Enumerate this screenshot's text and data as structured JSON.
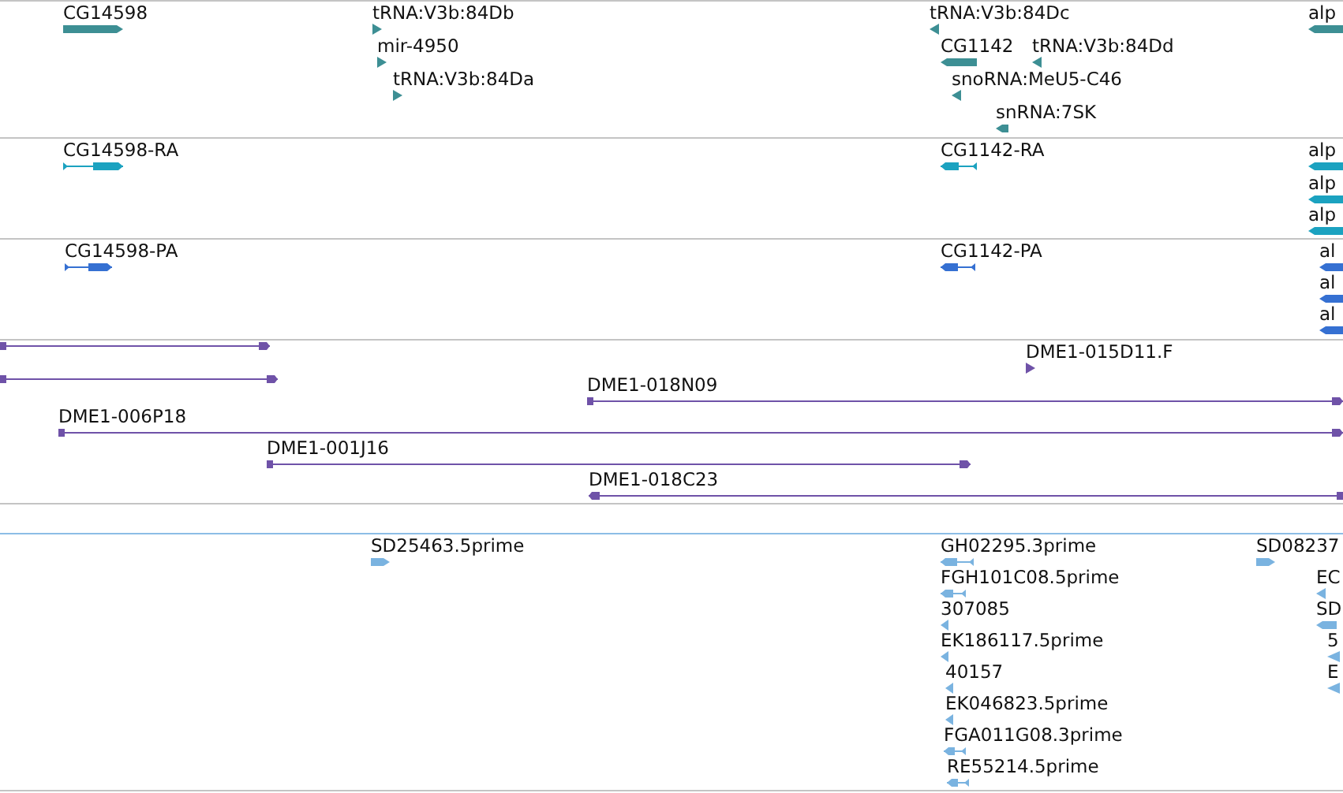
{
  "tracks": [
    {
      "color": "#3d8f94",
      "features": [
        {
          "label": "CG14598",
          "kind": "gene",
          "reverse": false
        },
        {
          "label": "tRNA:V3b:84Db",
          "kind": "small",
          "reverse": false
        },
        {
          "label": "mir-4950",
          "kind": "small",
          "reverse": false
        },
        {
          "label": "tRNA:V3b:84Da",
          "kind": "small",
          "reverse": false
        },
        {
          "label": "tRNA:V3b:84Dc",
          "kind": "small",
          "reverse": true
        },
        {
          "label": "CG1142",
          "kind": "gene",
          "reverse": true
        },
        {
          "label": "tRNA:V3b:84Dd",
          "kind": "small",
          "reverse": true
        },
        {
          "label": "snoRNA:MeU5-C46",
          "kind": "small",
          "reverse": true
        },
        {
          "label": "snRNA:7SK",
          "kind": "gene",
          "reverse": true
        },
        {
          "label": "alp",
          "kind": "gene",
          "reverse": true
        }
      ]
    },
    {
      "color": "#1ba2c0",
      "features": [
        {
          "label": "CG14598-RA",
          "kind": "transcript",
          "reverse": false
        },
        {
          "label": "CG1142-RA",
          "kind": "transcript",
          "reverse": true
        },
        {
          "label": "alp",
          "kind": "gene",
          "reverse": true
        },
        {
          "label": "alp",
          "kind": "gene",
          "reverse": true
        },
        {
          "label": "alp",
          "kind": "gene",
          "reverse": true
        }
      ]
    },
    {
      "color": "#3570d2",
      "features": [
        {
          "label": "CG14598-PA",
          "kind": "transcript",
          "reverse": false
        },
        {
          "label": "CG1142-PA",
          "kind": "transcript",
          "reverse": true
        },
        {
          "label": "al",
          "kind": "gene",
          "reverse": true
        },
        {
          "label": "al",
          "kind": "gene",
          "reverse": true
        },
        {
          "label": "al",
          "kind": "gene",
          "reverse": true
        }
      ]
    },
    {
      "color": "#6f52a8",
      "features": [
        {
          "kind": "clone",
          "reverse": false
        },
        {
          "kind": "clone",
          "reverse": false
        },
        {
          "label": "DME1-015D11.F",
          "kind": "small",
          "reverse": false
        },
        {
          "label": "DME1-018N09",
          "kind": "clone",
          "reverse": false
        },
        {
          "label": "DME1-006P18",
          "kind": "clone",
          "reverse": false
        },
        {
          "label": "DME1-001J16",
          "kind": "clone",
          "reverse": false
        },
        {
          "label": "DME1-018C23",
          "kind": "clone",
          "reverse": true
        }
      ]
    },
    {
      "color": "#7ab3e0",
      "features": [
        {
          "label": "SD25463.5prime",
          "kind": "gene",
          "reverse": false
        },
        {
          "label": "GH02295.3prime",
          "kind": "transcript",
          "reverse": true
        },
        {
          "label": "FGH101C08.5prime",
          "kind": "transcript",
          "reverse": true
        },
        {
          "label": "307085",
          "kind": "small",
          "reverse": true
        },
        {
          "label": "EK186117.5prime",
          "kind": "small",
          "reverse": true
        },
        {
          "label": "40157",
          "kind": "small",
          "reverse": true
        },
        {
          "label": "EK046823.5prime",
          "kind": "small",
          "reverse": true
        },
        {
          "label": "FGA011G08.3prime",
          "kind": "transcript",
          "reverse": true
        },
        {
          "label": "RE55214.5prime",
          "kind": "transcript",
          "reverse": true
        },
        {
          "label": "SD08237",
          "kind": "gene",
          "reverse": false
        },
        {
          "label": "EC",
          "kind": "small",
          "reverse": true
        },
        {
          "label": "SD",
          "kind": "gene",
          "reverse": true
        },
        {
          "label": "5",
          "kind": "small",
          "reverse": true
        },
        {
          "label": "E",
          "kind": "small",
          "reverse": true
        }
      ]
    }
  ]
}
